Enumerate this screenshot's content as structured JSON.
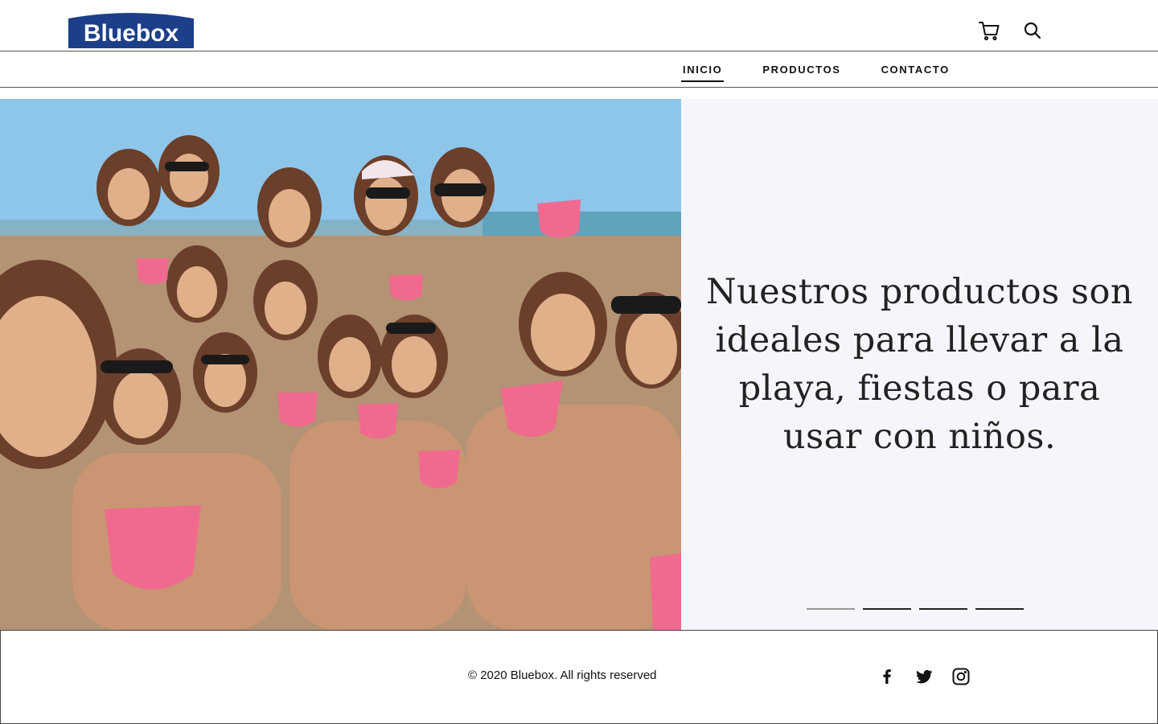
{
  "brand": {
    "logo_text": "Bluebox",
    "logo_bg": "#1d3f8a",
    "logo_fg": "#ffffff"
  },
  "header": {
    "icons": [
      "cart-icon",
      "search-icon"
    ]
  },
  "nav": {
    "items": [
      {
        "label": "INICIO",
        "active": true
      },
      {
        "label": "PRODUCTOS",
        "active": false
      },
      {
        "label": "CONTACTO",
        "active": false
      }
    ]
  },
  "hero": {
    "text": "Nuestros productos son ideales para llevar a la playa, fiestas o para usar con niños.",
    "slides": 4,
    "active_slide": 1,
    "image_colors": {
      "sky": "#8fc8ec",
      "cup": "#f06a8f"
    }
  },
  "footer": {
    "copyright": "© 2020 Bluebox. All rights reserved",
    "social": [
      "facebook-icon",
      "twitter-icon",
      "instagram-icon"
    ]
  }
}
